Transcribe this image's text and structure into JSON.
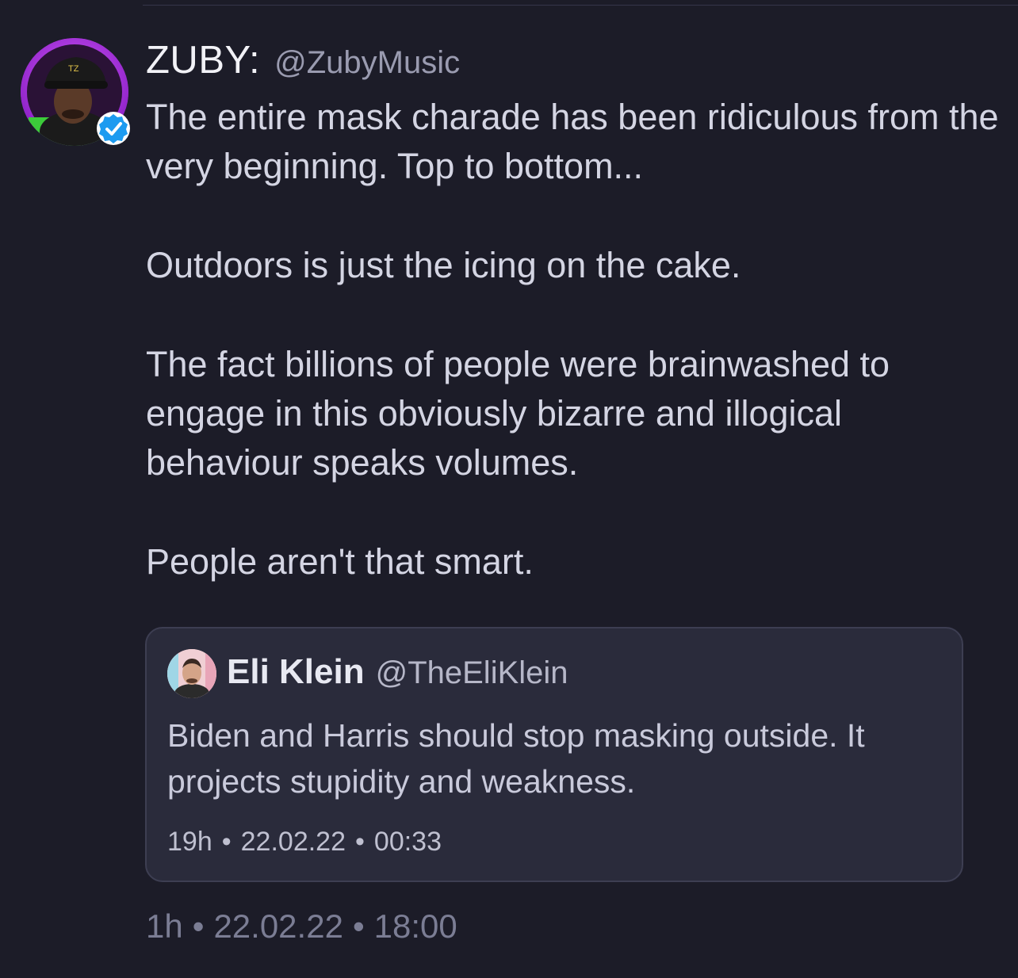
{
  "tweet": {
    "author_name": "ZUBY:",
    "author_handle": "@ZubyMusic",
    "verified_icon": "verified-badge-icon",
    "paragraphs": [
      "The entire mask charade has been ridiculous from the very beginning. Top to bottom...",
      "Outdoors is just the icing on the cake.",
      "The fact billions of people were brainwashed to engage in this obviously bizarre and illogical behaviour speaks volumes.",
      "People aren't that smart."
    ],
    "meta": {
      "age": "1h",
      "separator": "•",
      "date": "22.02.22",
      "time": "18:00"
    },
    "quote": {
      "author_name": "Eli Klein",
      "author_handle": "@TheEliKlein",
      "text": "Biden and Harris should stop masking outside. It projects stupidity and weakness.",
      "meta": {
        "age": "19h",
        "separator": "•",
        "date": "22.02.22",
        "time": "00:33"
      }
    }
  },
  "colors": {
    "background": "#1c1c28",
    "text_primary": "#f2f2f7",
    "text_body": "#d4d5e3",
    "text_muted": "#7b7d94",
    "card_background": "#2a2b3b",
    "card_border": "#3d3e52",
    "verified_blue": "#1d9bf0",
    "avatar_ring": "#b23ce0"
  }
}
